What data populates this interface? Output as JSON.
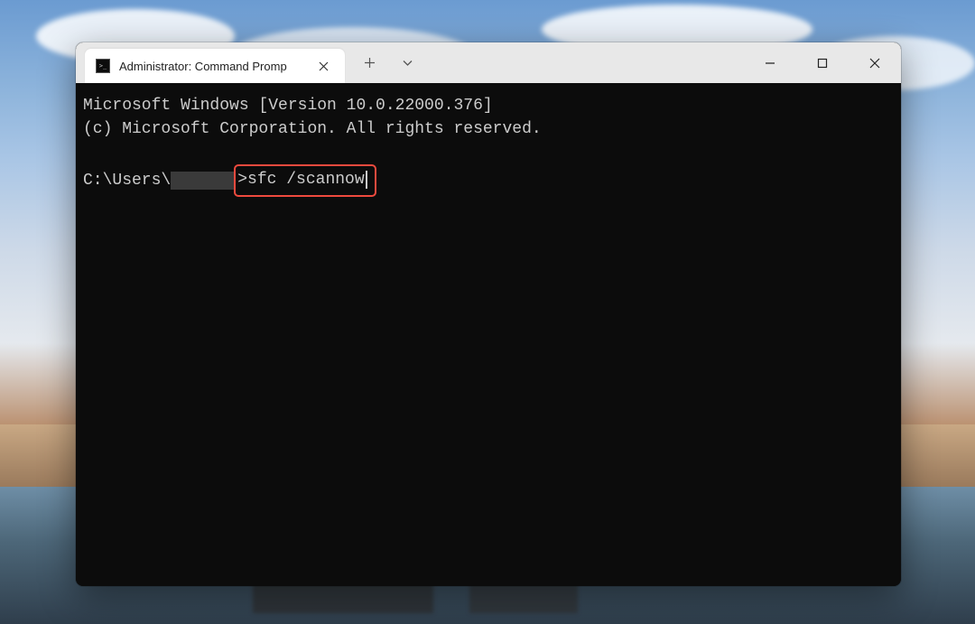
{
  "tab": {
    "title": "Administrator: Command Promp",
    "icon": "terminal-icon"
  },
  "terminal": {
    "header_line1": "Microsoft Windows [Version 10.0.22000.376]",
    "header_line2": "(c) Microsoft Corporation. All rights reserved.",
    "prompt_prefix": "C:\\Users\\",
    "prompt_suffix": ">",
    "command": "sfc /scannow"
  },
  "colors": {
    "terminal_bg": "#0c0c0c",
    "terminal_fg": "#cccccc",
    "highlight_border": "#ef4a3e",
    "titlebar_bg": "#e8e8e8",
    "tab_bg": "#ffffff"
  }
}
